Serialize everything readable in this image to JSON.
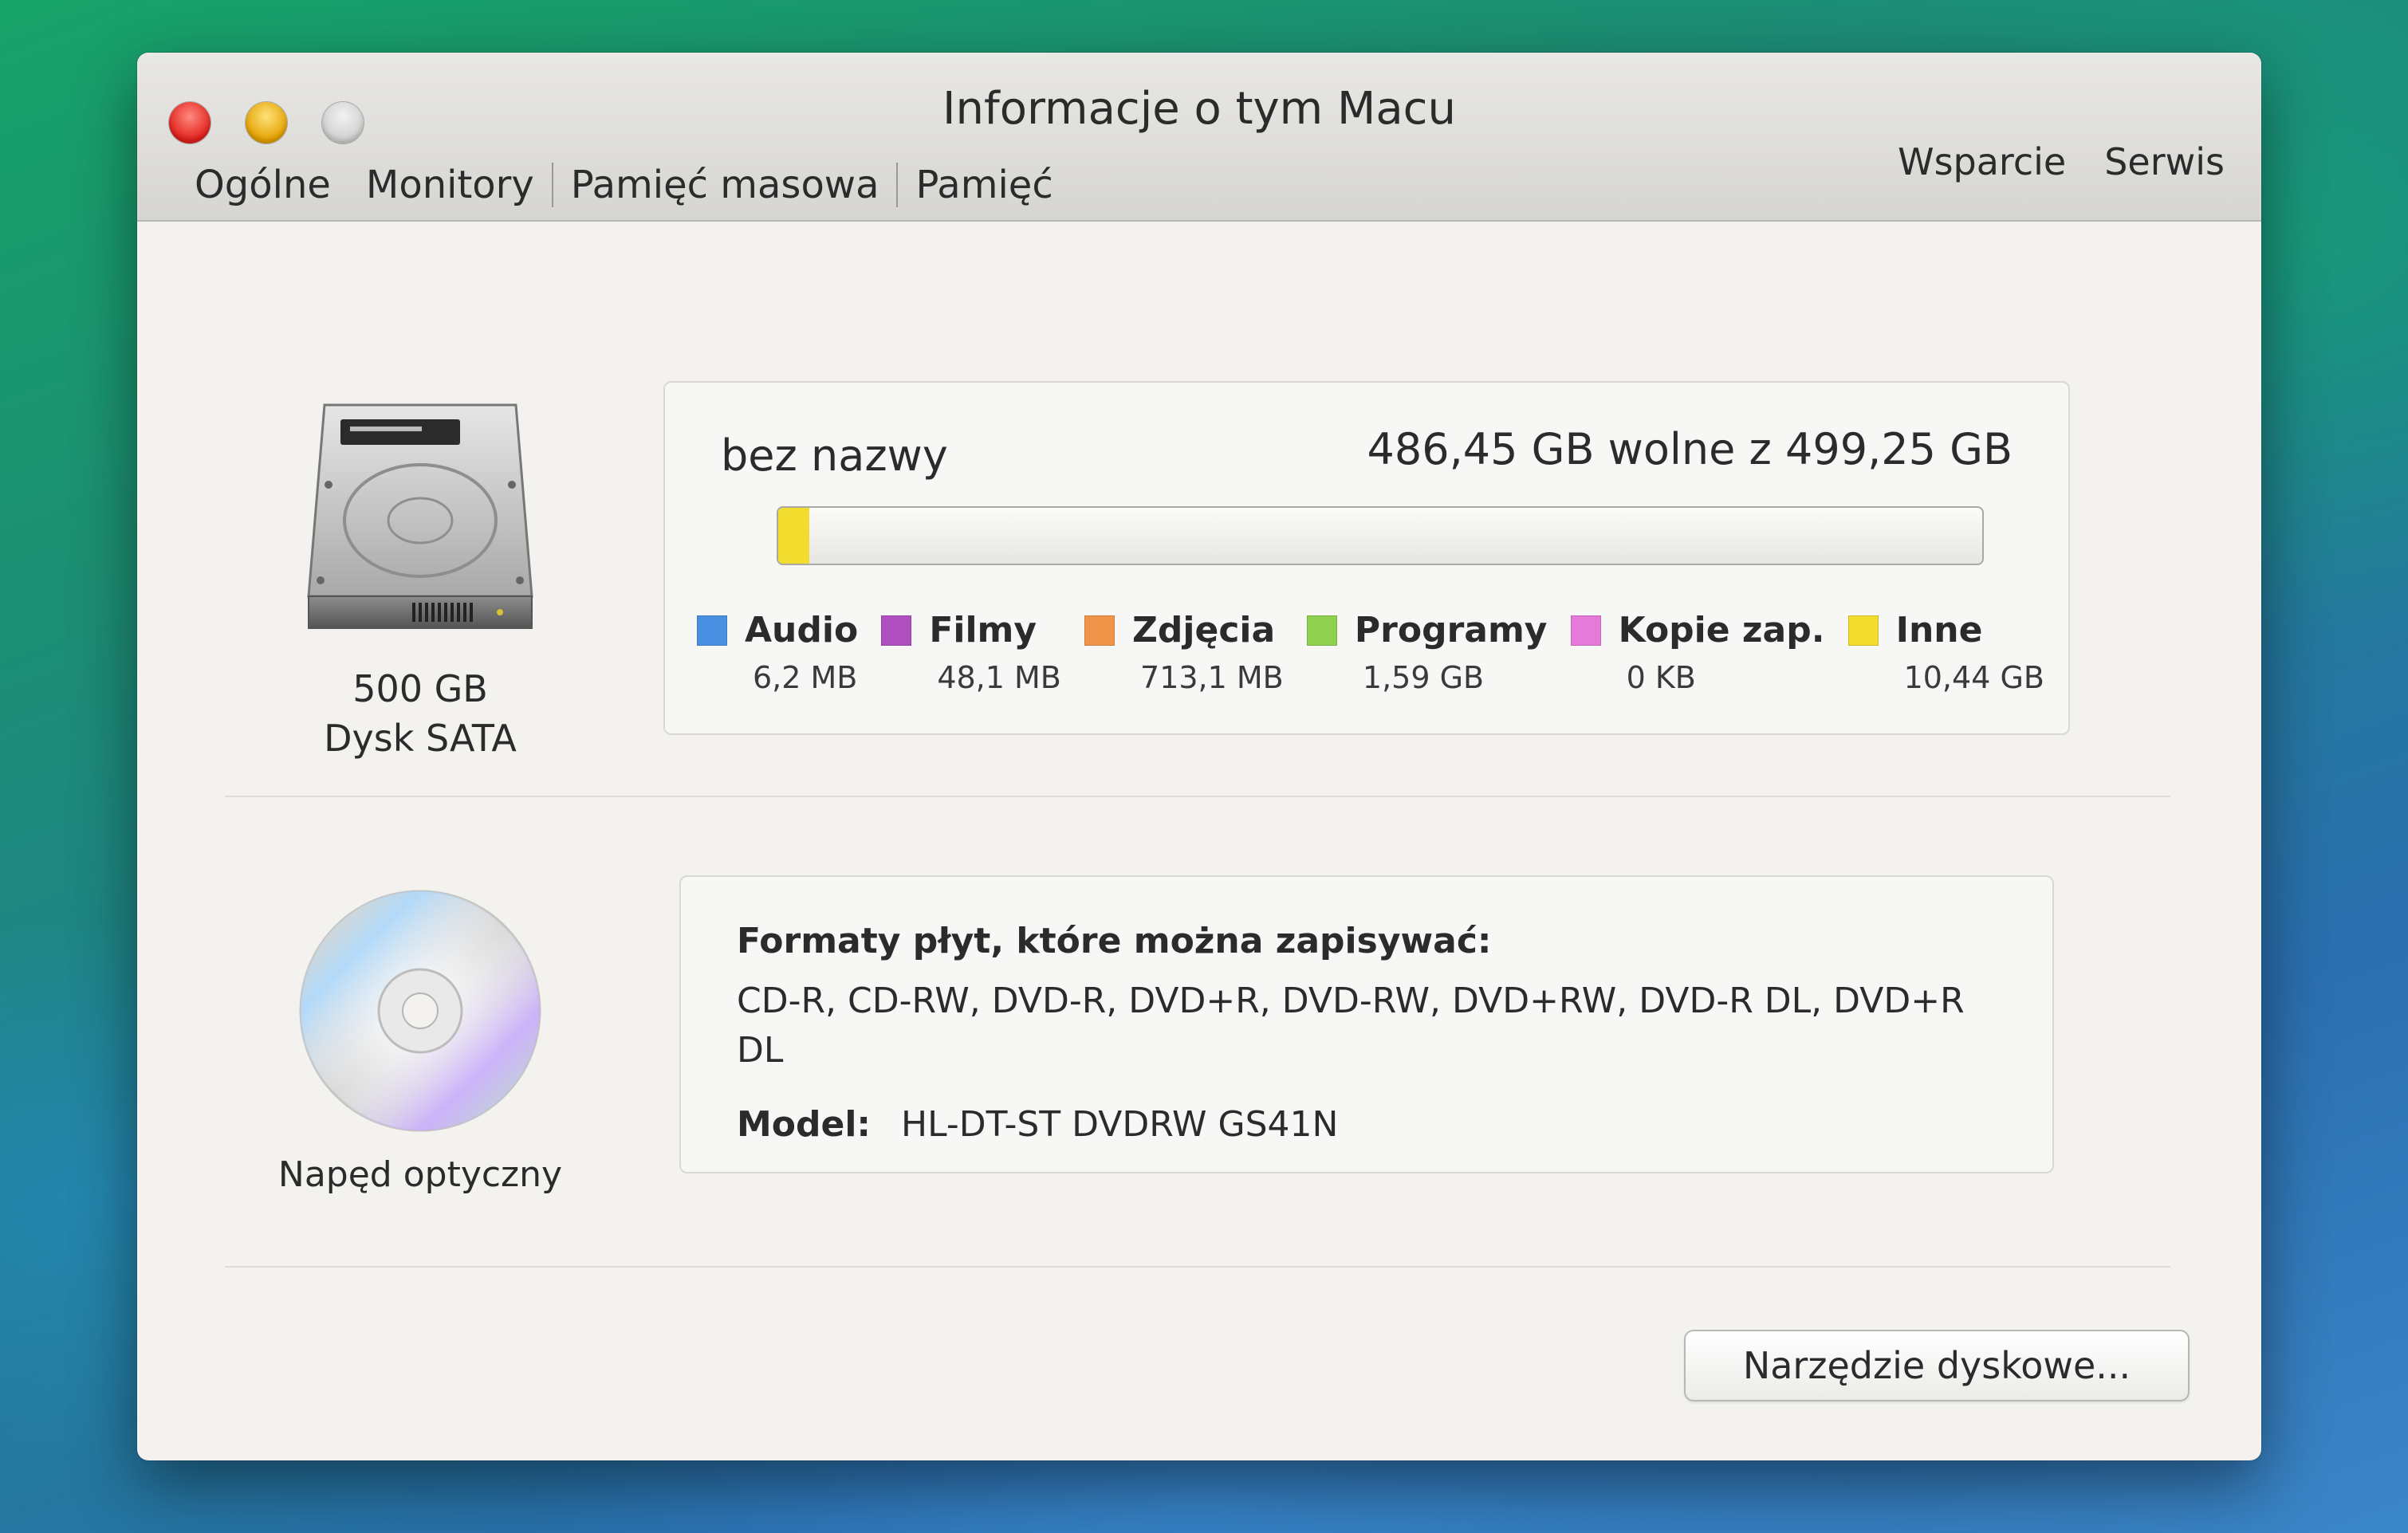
{
  "window": {
    "title": "Informacje o tym Macu",
    "tabs": [
      {
        "label": "Ogólne",
        "active": false
      },
      {
        "label": "Monitory",
        "active": false
      },
      {
        "label": "Pamięć masowa",
        "active": true
      },
      {
        "label": "Pamięć",
        "active": false
      }
    ],
    "links": {
      "support": "Wsparcie",
      "service": "Serwis"
    }
  },
  "drive": {
    "icon": "hard-drive-icon",
    "capacity": "500 GB",
    "type": "Dysk SATA",
    "volume_name": "bez nazwy",
    "free_text": "486,45 GB wolne z 499,25 GB",
    "used_fraction": 0.026,
    "legend": [
      {
        "label": "Audio",
        "value": "6,2 MB",
        "color": "#4a90e2"
      },
      {
        "label": "Filmy",
        "value": "48,1 MB",
        "color": "#b04fc0"
      },
      {
        "label": "Zdjęcia",
        "value": "713,1 MB",
        "color": "#f0944a"
      },
      {
        "label": "Programy",
        "value": "1,59 GB",
        "color": "#8fd14f"
      },
      {
        "label": "Kopie zap.",
        "value": "0 KB",
        "color": "#e67ad8"
      },
      {
        "label": "Inne",
        "value": "10,44 GB",
        "color": "#f2dc2e"
      }
    ]
  },
  "optical": {
    "icon": "optical-disc-icon",
    "caption": "Napęd optyczny",
    "burn_heading": "Formaty płyt, które można zapisywać:",
    "burn_formats": "CD-R, CD-RW, DVD-R, DVD+R, DVD-RW, DVD+RW, DVD-R DL, DVD+R DL",
    "model_label": "Model:",
    "model_value": "HL-DT-ST DVDRW GS41N"
  },
  "footer": {
    "disk_utility_button": "Narzędzie dyskowe..."
  }
}
